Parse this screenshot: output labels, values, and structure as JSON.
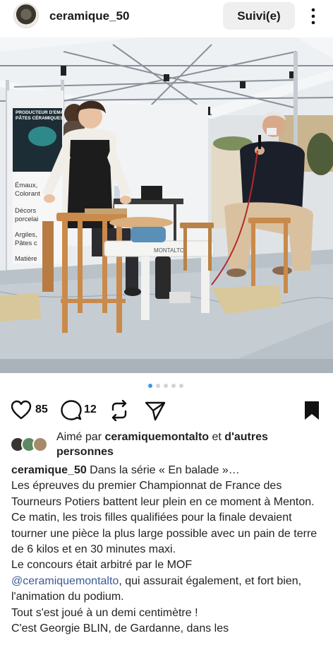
{
  "header": {
    "username": "ceramique_50",
    "follow_label": "Suivi(e)"
  },
  "photo": {
    "banner_lines": [
      "PRODUCTEUR D'EMAUX",
      "PÂTES CÉRAMIQUES ET",
      "Émaux,",
      "Colorant",
      "Décors",
      "porcelai",
      "Argiles,",
      "Pâtes c",
      "Matière"
    ],
    "wheel_label": "MONTALTO"
  },
  "carousel": {
    "total": 5,
    "active": 0
  },
  "actions": {
    "likes": "85",
    "comments": "12"
  },
  "liked_by": {
    "prefix": "Aimé par ",
    "user": "ceramiquemontalto",
    "middle": " et ",
    "suffix": "d'autres personnes"
  },
  "caption": {
    "username": "ceramique_50",
    "first_line": " Dans la série « En balade »…",
    "line_2": "Les épreuves du premier Championnat de France des Tourneurs Potiers battent leur plein en ce moment à Menton.",
    "line_3": "Ce matin, les trois filles qualifiées pour la finale devaient tourner une pièce la plus large possible avec un pain de terre de 6 kilos et en 30 minutes maxi.",
    "line_4": "Le concours était arbitré par le MOF",
    "mention": "@ceramiquemontalto",
    "line_5_rest": ", qui assurait également, et fort bien, l'animation du podium.",
    "line_6": "Tout s'est joué à un demi centimètre !",
    "line_7": "C'est Georgie BLIN, de Gardanne, dans les"
  },
  "colors": {
    "mention": "#3a5a98",
    "follow_bg": "#efefef",
    "dot_active": "#3897f0",
    "dot_inactive": "#d4d4d4"
  },
  "icons": [
    "heart-icon",
    "comment-icon",
    "repost-icon",
    "share-icon",
    "bookmark-icon",
    "more-icon"
  ]
}
